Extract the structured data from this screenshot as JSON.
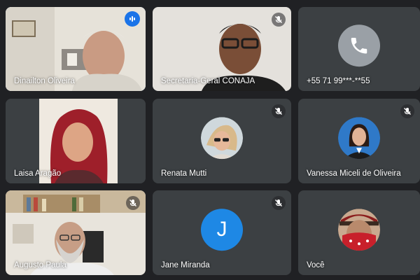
{
  "participants": [
    {
      "name": "Dinailton Oliveira",
      "mic": "speaking"
    },
    {
      "name": "Secretaria-Geral CONAJA",
      "mic": "muted"
    },
    {
      "name": "+55 71 99***-**55",
      "mic": "none",
      "avatar": "phone-icon",
      "avatar_color": "#9aa0a6"
    },
    {
      "name": "Laisa Aragão",
      "mic": "none"
    },
    {
      "name": "Renata Mutti",
      "mic": "muted"
    },
    {
      "name": "Vanessa Miceli de Oliveira",
      "mic": "muted"
    },
    {
      "name": "Augusto Paula",
      "mic": "muted"
    },
    {
      "name": "Jane Miranda",
      "mic": "muted",
      "avatar_letter": "J",
      "avatar_color": "#1e88e5"
    },
    {
      "name": "Você",
      "mic": "none"
    }
  ]
}
